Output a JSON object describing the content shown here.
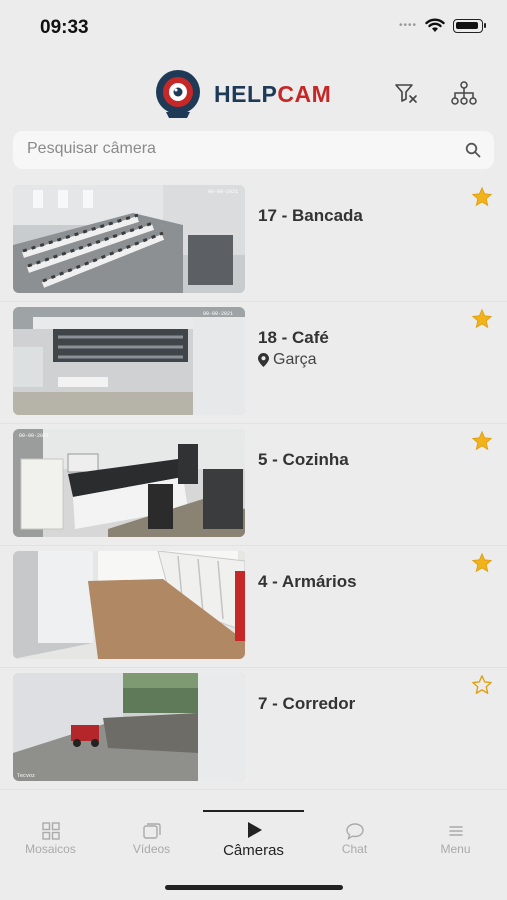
{
  "status_bar": {
    "time": "09:33"
  },
  "header": {
    "logo_part1": "HELP",
    "logo_part2": "CAM"
  },
  "search": {
    "placeholder": "Pesquisar câmera",
    "value": ""
  },
  "cameras": [
    {
      "name": "17 - Bancada",
      "location": "",
      "favorite": true,
      "scene": "office-wide"
    },
    {
      "name": "18 - Café",
      "location": "Garça",
      "favorite": true,
      "scene": "office-large"
    },
    {
      "name": "5 - Cozinha",
      "location": "",
      "favorite": true,
      "scene": "kitchen"
    },
    {
      "name": "4 - Armários",
      "location": "",
      "favorite": true,
      "scene": "lockers"
    },
    {
      "name": "7 - Corredor",
      "location": "",
      "favorite": false,
      "scene": "corridor"
    }
  ],
  "tabs": [
    {
      "label": "Mosaicos",
      "icon": "grid-icon",
      "active": false
    },
    {
      "label": "Vídeos",
      "icon": "videos-icon",
      "active": false
    },
    {
      "label": "Câmeras",
      "icon": "play-icon",
      "active": true
    },
    {
      "label": "Chat",
      "icon": "chat-icon",
      "active": false
    },
    {
      "label": "Menu",
      "icon": "menu-icon",
      "active": false
    }
  ],
  "colors": {
    "star": "#f2b21b",
    "logo_dark": "#1f3a56",
    "logo_red": "#c62828",
    "background": "#ececec"
  }
}
